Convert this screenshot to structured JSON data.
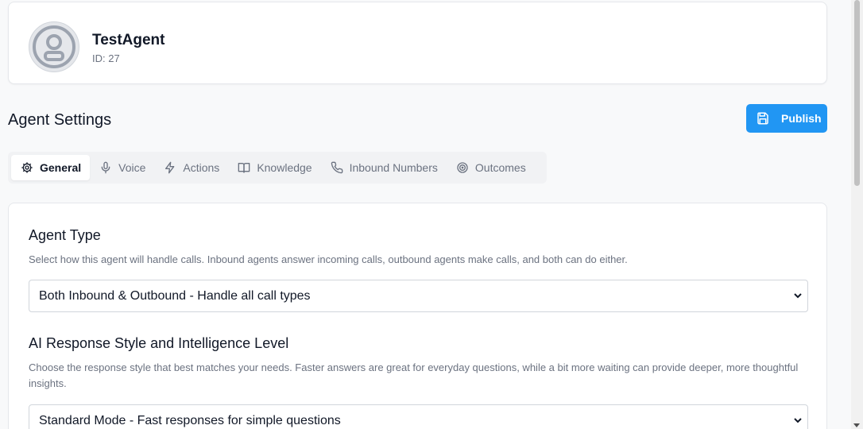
{
  "agent": {
    "name": "TestAgent",
    "id_label": "ID: 27"
  },
  "settings": {
    "title": "Agent Settings",
    "publish_label": "Publish"
  },
  "tabs": [
    {
      "label": "General",
      "icon": "gear-icon",
      "active": true
    },
    {
      "label": "Voice",
      "icon": "microphone-icon",
      "active": false
    },
    {
      "label": "Actions",
      "icon": "lightning-icon",
      "active": false
    },
    {
      "label": "Knowledge",
      "icon": "book-icon",
      "active": false
    },
    {
      "label": "Inbound Numbers",
      "icon": "phone-icon",
      "active": false
    },
    {
      "label": "Outcomes",
      "icon": "target-icon",
      "active": false
    }
  ],
  "agent_type": {
    "title": "Agent Type",
    "description": "Select how this agent will handle calls. Inbound agents answer incoming calls, outbound agents make calls, and both can do either.",
    "selected": "Both Inbound & Outbound - Handle all call types"
  },
  "response_style": {
    "title": "AI Response Style and Intelligence Level",
    "description": "Choose the response style that best matches your needs. Faster answers are great for everyday questions, while a bit more waiting can provide deeper, more thoughtful insights.",
    "selected": "Standard Mode - Fast responses for simple questions"
  },
  "colors": {
    "accent": "#2196f3",
    "background": "#f8f9fa"
  }
}
